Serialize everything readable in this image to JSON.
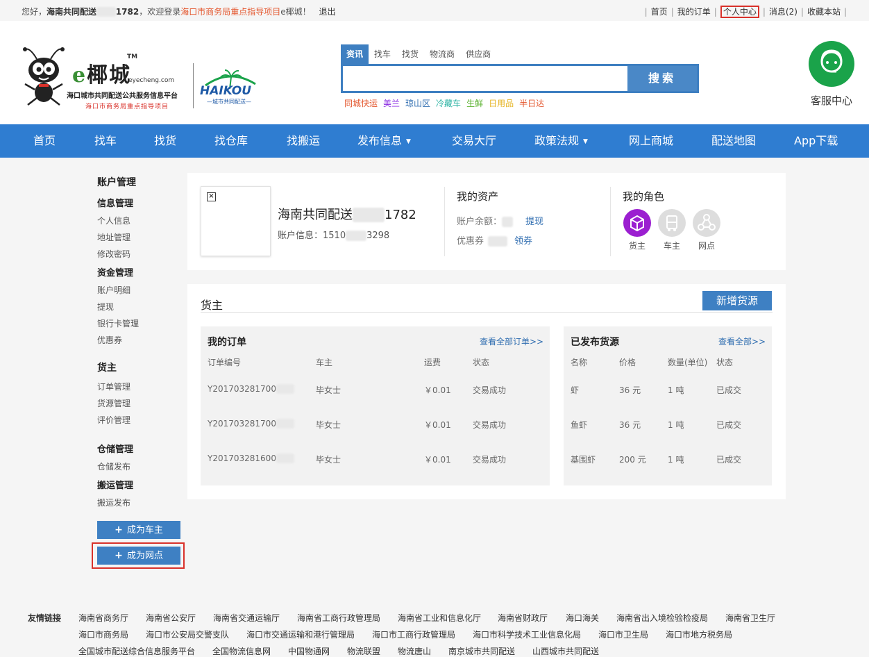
{
  "topbar": {
    "greeting": "您好，",
    "user_prefix": "海南共同配送",
    "user_suffix": "1782",
    "welcome": "，欢迎登录",
    "project": "海口市商务局重点指导项目",
    "site": "e椰城！",
    "logout": "退出",
    "links": [
      "首页",
      "我的订单",
      "个人中心",
      "消息(2)",
      "收藏本站"
    ]
  },
  "brand": {
    "e": "e",
    "name": "椰城",
    "tm": "TM",
    "domain": "eyecheng.com",
    "subtitle": "海口城市共同配送公共服务信息平台",
    "red_note": "海口市商务局重点指导项目",
    "haikou": "HAIKOU",
    "haikou_sub": "—城市共同配送—"
  },
  "search": {
    "tabs": [
      "资讯",
      "找车",
      "找货",
      "物流商",
      "供应商"
    ],
    "active_tab": 0,
    "placeholder": "",
    "button": "搜索",
    "hot": [
      {
        "label": "同城快运",
        "color": "#e4572e"
      },
      {
        "label": "美兰",
        "color": "#8a2be2"
      },
      {
        "label": "琼山区",
        "color": "#2f6db0"
      },
      {
        "label": "冷藏车",
        "color": "#2bb3a3"
      },
      {
        "label": "生鲜",
        "color": "#58b02c"
      },
      {
        "label": "日用品",
        "color": "#e6b422"
      },
      {
        "label": "半日达",
        "color": "#e4572e"
      }
    ]
  },
  "service": {
    "label": "客服中心"
  },
  "nav": [
    "首页",
    "找车",
    "找货",
    "找仓库",
    "找搬运",
    "发布信息",
    "交易大厅",
    "政策法规",
    "网上商城",
    "配送地图",
    "App下载"
  ],
  "sidebar": {
    "title": "账户管理",
    "info_group": "信息管理",
    "info_items": [
      "个人信息",
      "地址管理",
      "修改密码"
    ],
    "fund_group": "资金管理",
    "fund_items": [
      "账户明细",
      "提现",
      "银行卡管理",
      "优惠券"
    ],
    "shipper_title": "货主",
    "shipper_items": [
      "订单管理",
      "货源管理",
      "评价管理"
    ],
    "storage_group": "仓储管理",
    "storage_items": [
      "仓储发布"
    ],
    "move_group": "搬运管理",
    "move_items": [
      "搬运发布"
    ],
    "btn_driver": "成为车主",
    "btn_point": "成为网点"
  },
  "profile": {
    "name_prefix": "海南共同配送",
    "name_suffix": "1782",
    "acct_label": "账户信息：",
    "acct_prefix": "1510",
    "acct_suffix": "3298",
    "assets_title": "我的资产",
    "balance_label": "账户余额：",
    "withdraw": "提现",
    "coupon_label": "优惠券",
    "get_coupon": "领券",
    "roles_title": "我的角色",
    "roles": [
      "货主",
      "车主",
      "网点"
    ]
  },
  "shipper": {
    "title": "货主",
    "add_button": "新增货源",
    "orders": {
      "title": "我的订单",
      "more": "查看全部订单>>",
      "headers": [
        "订单编号",
        "车主",
        "运费",
        "状态"
      ],
      "rows": [
        {
          "id": "Y201703281700",
          "owner": "毕女士",
          "fee": "￥0.01",
          "status": "交易成功"
        },
        {
          "id": "Y201703281700",
          "owner": "毕女士",
          "fee": "￥0.01",
          "status": "交易成功"
        },
        {
          "id": "Y201703281600",
          "owner": "毕女士",
          "fee": "￥0.01",
          "status": "交易成功"
        }
      ]
    },
    "goods": {
      "title": "已发布货源",
      "more": "查看全部>>",
      "headers": [
        "名称",
        "价格",
        "数量(单位)",
        "状态"
      ],
      "rows": [
        {
          "name": "虾",
          "price": "36 元",
          "qty": "1 吨",
          "status": "已成交"
        },
        {
          "name": "鱼虾",
          "price": "36 元",
          "qty": "1 吨",
          "status": "已成交"
        },
        {
          "name": "基围虾",
          "price": "200 元",
          "qty": "1 吨",
          "status": "已成交"
        }
      ]
    }
  },
  "friend_links": {
    "label": "友情链接",
    "row1": [
      "海南省商务厅",
      "海南省公安厅",
      "海南省交通运输厅",
      "海南省工商行政管理局",
      "海南省工业和信息化厅",
      "海南省财政厅",
      "海口海关",
      "海南省出入境检验检疫局",
      "海南省卫生厅"
    ],
    "row2": [
      "海口市商务局",
      "海口市公安局交警支队",
      "海口市交通运输和港行管理局",
      "海口市工商行政管理局",
      "海口市科学技术工业信息化局",
      "海口市卫生局",
      "海口市地方税务局"
    ],
    "row3": [
      "全国城市配送综合信息服务平台",
      "全国物流信息网",
      "中国物通网",
      "物流联盟",
      "物流唐山",
      "南京城市共同配送",
      "山西城市共同配送"
    ]
  },
  "colors": {
    "nav": "#2f7dd1",
    "button": "#3e80c3",
    "highlight": "#d9312a",
    "service": "#1aa34a"
  }
}
